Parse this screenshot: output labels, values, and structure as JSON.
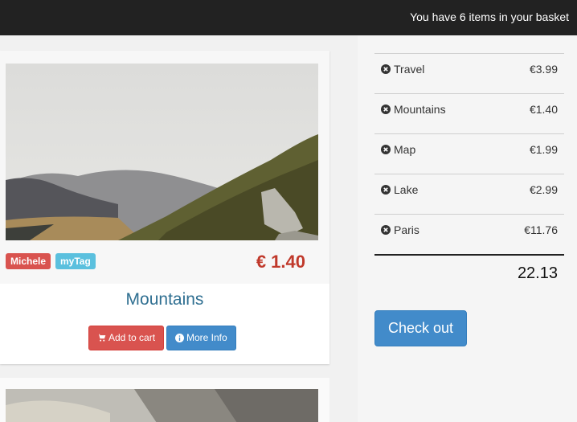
{
  "header": {
    "basket_text": "You have 6 items in your basket"
  },
  "product": {
    "title": "Mountains",
    "price": "€ 1.40",
    "tags": [
      "Michele",
      "myTag"
    ],
    "add_to_cart_label": "Add to cart",
    "more_info_label": "More Info"
  },
  "basket": {
    "items": [
      {
        "name": "Travel",
        "price": "€3.99"
      },
      {
        "name": "Mountains",
        "price": "€1.40"
      },
      {
        "name": "Map",
        "price": "€1.99"
      },
      {
        "name": "Lake",
        "price": "€2.99"
      },
      {
        "name": "Paris",
        "price": "€11.76"
      }
    ],
    "total": "22.13",
    "checkout_label": "Check out"
  },
  "colors": {
    "topbar": "#222222",
    "price": "#c0392b",
    "danger": "#d9534f",
    "info": "#5bc0de",
    "primary": "#428bca",
    "title": "#2f6f91"
  }
}
